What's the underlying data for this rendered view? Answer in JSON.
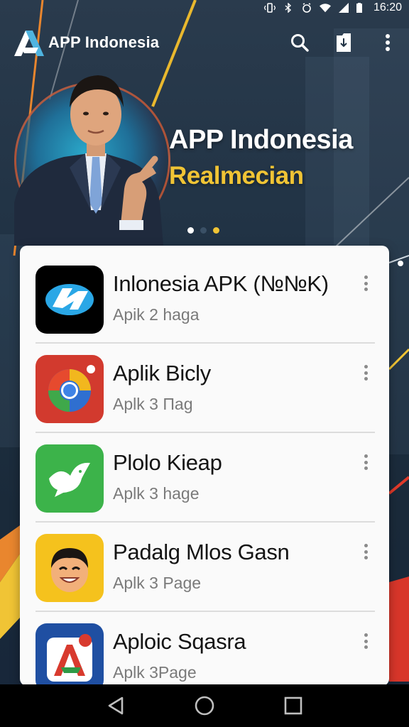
{
  "status_bar": {
    "time": "16:20",
    "icons": [
      "vibrate-icon",
      "bluetooth-icon",
      "alarm-icon",
      "wifi-icon",
      "signal-icon",
      "battery-icon"
    ]
  },
  "app_bar": {
    "title": "APP Indonesia",
    "actions": [
      "search-icon",
      "download-icon",
      "more-vert-icon"
    ]
  },
  "hero": {
    "title": "APP Indonesia",
    "subtitle": "Realmecian",
    "slide_count": 3,
    "active_slide": 1,
    "colors": {
      "subtitle": "#f0c435",
      "accent_ring": "#e86030"
    }
  },
  "apps": [
    {
      "name": "Inlonesia APK (№№K)",
      "meta": "Apik 2 haga",
      "icon": "fingerprint-logo-icon"
    },
    {
      "name": "Aplik Bicly",
      "meta": "Aplk 3 Πag",
      "icon": "browser-logo-icon"
    },
    {
      "name": "Plolo Kieap",
      "meta": "Aplk 3 hage",
      "icon": "dove-icon"
    },
    {
      "name": "Padalg Mlos Gasn",
      "meta": "Aplk 3 Page",
      "icon": "smiley-face-icon"
    },
    {
      "name": "Aploic Sqasra",
      "meta": "Aplk 3Page",
      "icon": "letter-a-logo-icon"
    }
  ],
  "nav_bar": [
    "back-icon",
    "home-icon",
    "recents-icon"
  ]
}
